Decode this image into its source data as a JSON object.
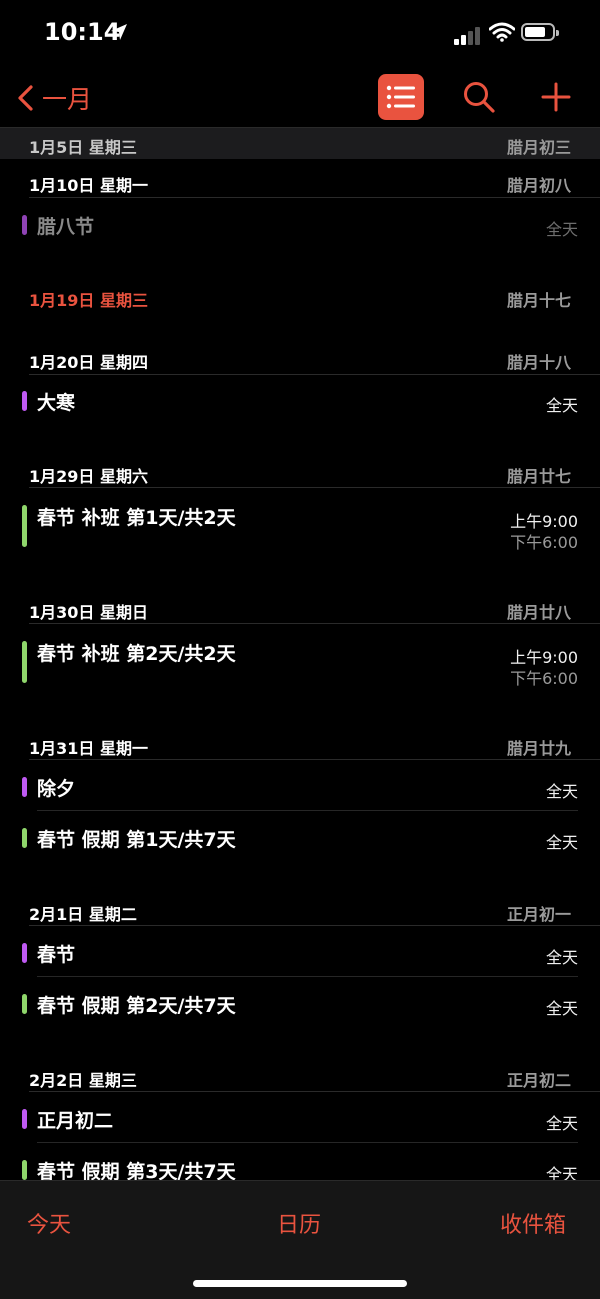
{
  "status_bar": {
    "time": "10:14"
  },
  "nav": {
    "back_label": "一月"
  },
  "colors": {
    "accent": "#e9533f",
    "purple": "#bf5af2",
    "green": "#8fd66b"
  },
  "agenda": [
    {
      "date": "1月5日 星期三",
      "lunar": "腊月初三"
    },
    {
      "date": "1月10日 星期一",
      "lunar": "腊月初八"
    },
    {
      "title": "腊八节",
      "time": "全天"
    },
    {
      "date": "1月19日 星期三",
      "lunar": "腊月十七"
    },
    {
      "date": "1月20日 星期四",
      "lunar": "腊月十八"
    },
    {
      "title": "大寒",
      "time": "全天"
    },
    {
      "date": "1月29日 星期六",
      "lunar": "腊月廿七"
    },
    {
      "title": "春节 补班 第1天/共2天",
      "start": "上午9:00",
      "end": "下午6:00"
    },
    {
      "date": "1月30日 星期日",
      "lunar": "腊月廿八"
    },
    {
      "title": "春节 补班 第2天/共2天",
      "start": "上午9:00",
      "end": "下午6:00"
    },
    {
      "date": "1月31日 星期一",
      "lunar": "腊月廿九"
    },
    {
      "title": "除夕",
      "time": "全天"
    },
    {
      "title": "春节 假期 第1天/共7天",
      "time": "全天"
    },
    {
      "date": "2月1日 星期二",
      "lunar": "正月初一"
    },
    {
      "title": "春节",
      "time": "全天"
    },
    {
      "title": "春节 假期 第2天/共7天",
      "time": "全天"
    },
    {
      "date": "2月2日 星期三",
      "lunar": "正月初二"
    },
    {
      "title": "正月初二",
      "time": "全天"
    },
    {
      "title": "春节 假期 第3天/共7天",
      "time": "全天"
    }
  ],
  "tabbar": {
    "today": "今天",
    "calendars": "日历",
    "inbox": "收件箱"
  }
}
